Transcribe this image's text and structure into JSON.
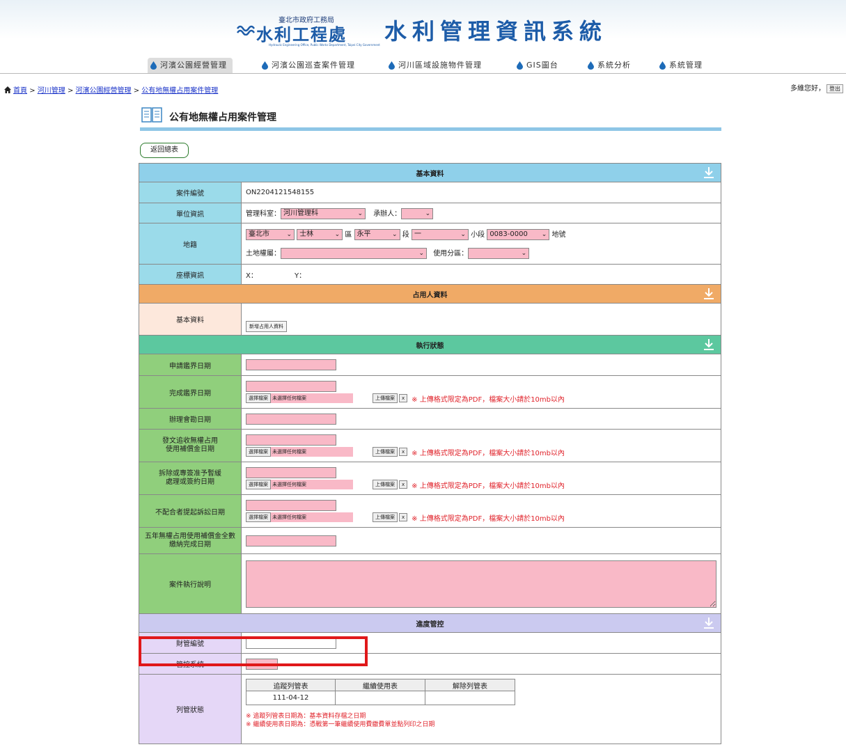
{
  "header": {
    "agency_small": "臺北市政府工務局",
    "agency_big": "水利工程處",
    "agency_en": "Hydraulic Engineering Office, Public Works Department, Taipei City Government",
    "system_title": "水利管理資訊系統"
  },
  "nav": {
    "items": [
      {
        "label": "河濱公園經營管理",
        "active": true
      },
      {
        "label": "河濱公園巡查案件管理"
      },
      {
        "label": "河川區域設施物件管理"
      },
      {
        "label": "GIS圖台"
      },
      {
        "label": "系統分析"
      },
      {
        "label": "系統管理"
      }
    ]
  },
  "breadcrumb": {
    "items": [
      "首頁",
      "河川管理",
      "河濱公園經營管理",
      "公有地無權占用案件管理"
    ],
    "sep": ">"
  },
  "user": {
    "greeting": "多維您好，",
    "logout": "登出"
  },
  "page": {
    "title": "公有地無權占用案件管理",
    "back": "返回總表"
  },
  "sections": {
    "basic": "基本資料",
    "occupant": "占用人資料",
    "status": "執行狀態",
    "progress": "進度管控"
  },
  "basic": {
    "case_no_label": "案件編號",
    "case_no": "ON2204121548155",
    "unit_label": "單位資訊",
    "dept_prefix": "管理科室：",
    "dept_value": "河川管理科",
    "handler_prefix": "承辦人：",
    "handler_value": "",
    "land_label": "地籍",
    "city": "臺北市",
    "district": "士林",
    "district_suffix": "區",
    "section": "永平",
    "section_suffix": "段",
    "subsection": "一",
    "subsection_suffix": "小段",
    "lot": "0083-0000",
    "lot_suffix": "地號",
    "ownership_prefix": "土地權屬：",
    "zoning_prefix": "使用分區：",
    "coord_label": "座標資訊",
    "coord_x": "X：",
    "coord_y": "Y："
  },
  "occupant": {
    "label": "基本資料",
    "add_btn": "新增占用人資料"
  },
  "status": {
    "rows": [
      {
        "label": "申請鑑界日期"
      },
      {
        "label": "完成鑑界日期"
      },
      {
        "label": "辦理會勘日期"
      },
      {
        "label": "發文追收無權占用\n使用補償金日期"
      },
      {
        "label": "拆除或專簽准予暫緩\n處理或簽約日期"
      },
      {
        "label": "不配合者提起訴訟日期"
      },
      {
        "label": "五年無權占用使用補償金全數\n繳納完成日期"
      },
      {
        "label": "案件執行說明"
      }
    ],
    "choose_file": "選擇檔案",
    "no_file": "未選擇任何檔案",
    "upload": "上傳檔案",
    "remove": "x",
    "upload_note": "※ 上傳格式限定為PDF，檔案大小請於10mb以內"
  },
  "progress": {
    "asset_label": "財管編號",
    "control_label": "管控系統",
    "list_label": "列管狀態",
    "headers": [
      "追蹤列管表",
      "繼續使用表",
      "解除列管表"
    ],
    "values": [
      "111-04-12",
      "",
      ""
    ],
    "note1": "※ 追蹤列管表日期為：基本資料存檔之日期",
    "note2": "※ 繼續使用表日期為：憑戰第一筆繼續使用費繳費單並點列印之日期"
  }
}
